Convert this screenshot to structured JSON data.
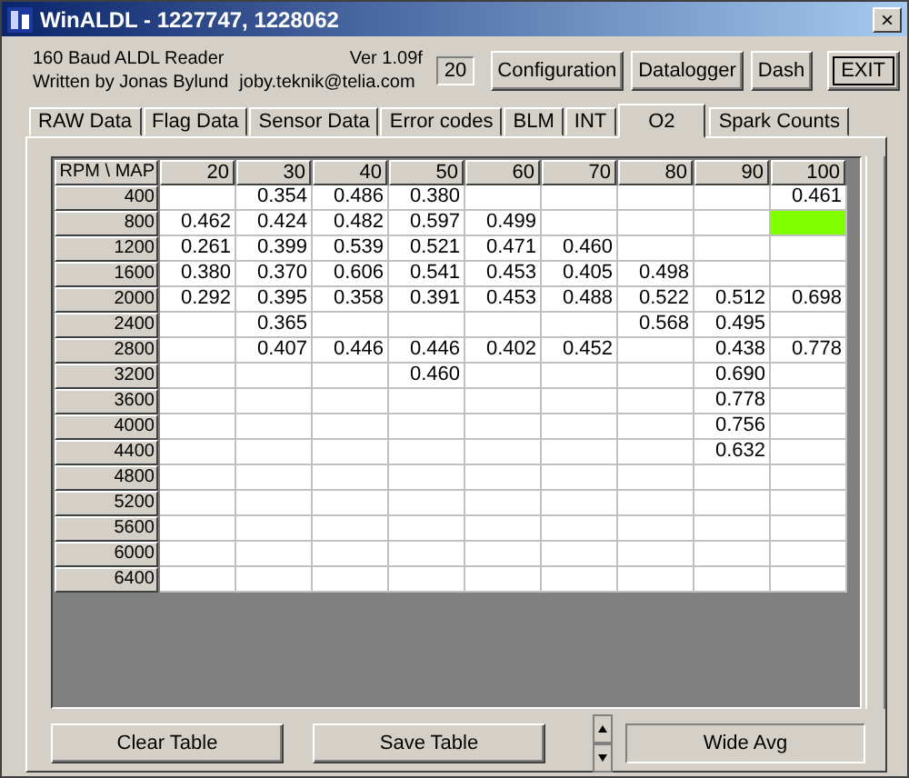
{
  "window": {
    "title": "WinALDL - 1227747, 1228062",
    "close": "×"
  },
  "header": {
    "line_1": "160 Baud ALDL Reader",
    "line_2": "Written by Jonas Bylund",
    "version": "Ver 1.09f",
    "email": "joby.teknik@telia.com",
    "counter": "20"
  },
  "buttons": [
    "Configuration",
    "Datalogger",
    "Dash"
  ],
  "exit_button": "EXIT",
  "tabs": [
    {
      "label": "RAW Data",
      "selected": false
    },
    {
      "label": "Flag Data",
      "selected": false
    },
    {
      "label": "Sensor Data",
      "selected": false
    },
    {
      "label": "Error codes",
      "selected": false
    },
    {
      "label": "BLM",
      "selected": false
    },
    {
      "label": "INT",
      "selected": false
    },
    {
      "label": "O2",
      "selected": true
    },
    {
      "label": "Spark Counts",
      "selected": false
    }
  ],
  "table": {
    "corner": "RPM \\ MAP",
    "columns": [
      "20",
      "30",
      "40",
      "50",
      "60",
      "70",
      "80",
      "90",
      "100"
    ],
    "rows": [
      {
        "rpm": "400",
        "cells": [
          "",
          "0.354",
          "0.486",
          "0.380",
          "",
          "",
          "",
          "",
          "0.461"
        ],
        "selected": [
          false,
          false,
          false,
          false,
          false,
          false,
          false,
          false,
          false
        ]
      },
      {
        "rpm": "800",
        "cells": [
          "0.462",
          "0.424",
          "0.482",
          "0.597",
          "0.499",
          "",
          "",
          "",
          ""
        ],
        "selected": [
          false,
          false,
          false,
          false,
          false,
          false,
          false,
          false,
          true
        ]
      },
      {
        "rpm": "1200",
        "cells": [
          "0.261",
          "0.399",
          "0.539",
          "0.521",
          "0.471",
          "0.460",
          "",
          "",
          ""
        ],
        "selected": [
          false,
          false,
          false,
          false,
          false,
          false,
          false,
          false,
          false
        ]
      },
      {
        "rpm": "1600",
        "cells": [
          "0.380",
          "0.370",
          "0.606",
          "0.541",
          "0.453",
          "0.405",
          "0.498",
          "",
          ""
        ],
        "selected": [
          false,
          false,
          false,
          false,
          false,
          false,
          false,
          false,
          false
        ]
      },
      {
        "rpm": "2000",
        "cells": [
          "0.292",
          "0.395",
          "0.358",
          "0.391",
          "0.453",
          "0.488",
          "0.522",
          "0.512",
          "0.698"
        ],
        "selected": [
          false,
          false,
          false,
          false,
          false,
          false,
          false,
          false,
          false
        ]
      },
      {
        "rpm": "2400",
        "cells": [
          "",
          "0.365",
          "",
          "",
          "",
          "",
          "0.568",
          "0.495",
          ""
        ],
        "selected": [
          false,
          false,
          false,
          false,
          false,
          false,
          false,
          false,
          false
        ]
      },
      {
        "rpm": "2800",
        "cells": [
          "",
          "0.407",
          "0.446",
          "0.446",
          "0.402",
          "0.452",
          "",
          "0.438",
          "0.778"
        ],
        "selected": [
          false,
          false,
          false,
          false,
          false,
          false,
          false,
          false,
          false
        ]
      },
      {
        "rpm": "3200",
        "cells": [
          "",
          "",
          "",
          "0.460",
          "",
          "",
          "",
          "0.690",
          ""
        ],
        "selected": [
          false,
          false,
          false,
          false,
          false,
          false,
          false,
          false,
          false
        ]
      },
      {
        "rpm": "3600",
        "cells": [
          "",
          "",
          "",
          "",
          "",
          "",
          "",
          "0.778",
          ""
        ],
        "selected": [
          false,
          false,
          false,
          false,
          false,
          false,
          false,
          false,
          false
        ]
      },
      {
        "rpm": "4000",
        "cells": [
          "",
          "",
          "",
          "",
          "",
          "",
          "",
          "0.756",
          ""
        ],
        "selected": [
          false,
          false,
          false,
          false,
          false,
          false,
          false,
          false,
          false
        ]
      },
      {
        "rpm": "4400",
        "cells": [
          "",
          "",
          "",
          "",
          "",
          "",
          "",
          "0.632",
          ""
        ],
        "selected": [
          false,
          false,
          false,
          false,
          false,
          false,
          false,
          false,
          false
        ]
      },
      {
        "rpm": "4800",
        "cells": [
          "",
          "",
          "",
          "",
          "",
          "",
          "",
          "",
          ""
        ],
        "selected": [
          false,
          false,
          false,
          false,
          false,
          false,
          false,
          false,
          false
        ]
      },
      {
        "rpm": "5200",
        "cells": [
          "",
          "",
          "",
          "",
          "",
          "",
          "",
          "",
          ""
        ],
        "selected": [
          false,
          false,
          false,
          false,
          false,
          false,
          false,
          false,
          false
        ]
      },
      {
        "rpm": "5600",
        "cells": [
          "",
          "",
          "",
          "",
          "",
          "",
          "",
          "",
          ""
        ],
        "selected": [
          false,
          false,
          false,
          false,
          false,
          false,
          false,
          false,
          false
        ]
      },
      {
        "rpm": "6000",
        "cells": [
          "",
          "",
          "",
          "",
          "",
          "",
          "",
          "",
          ""
        ],
        "selected": [
          false,
          false,
          false,
          false,
          false,
          false,
          false,
          false,
          false
        ]
      },
      {
        "rpm": "6400",
        "cells": [
          "",
          "",
          "",
          "",
          "",
          "",
          "",
          "",
          ""
        ],
        "selected": [
          false,
          false,
          false,
          false,
          false,
          false,
          false,
          false,
          false
        ]
      }
    ]
  },
  "footer": {
    "clear_button": "Clear Table",
    "save_button": "Save Table",
    "mode_button": "Wide Avg"
  }
}
